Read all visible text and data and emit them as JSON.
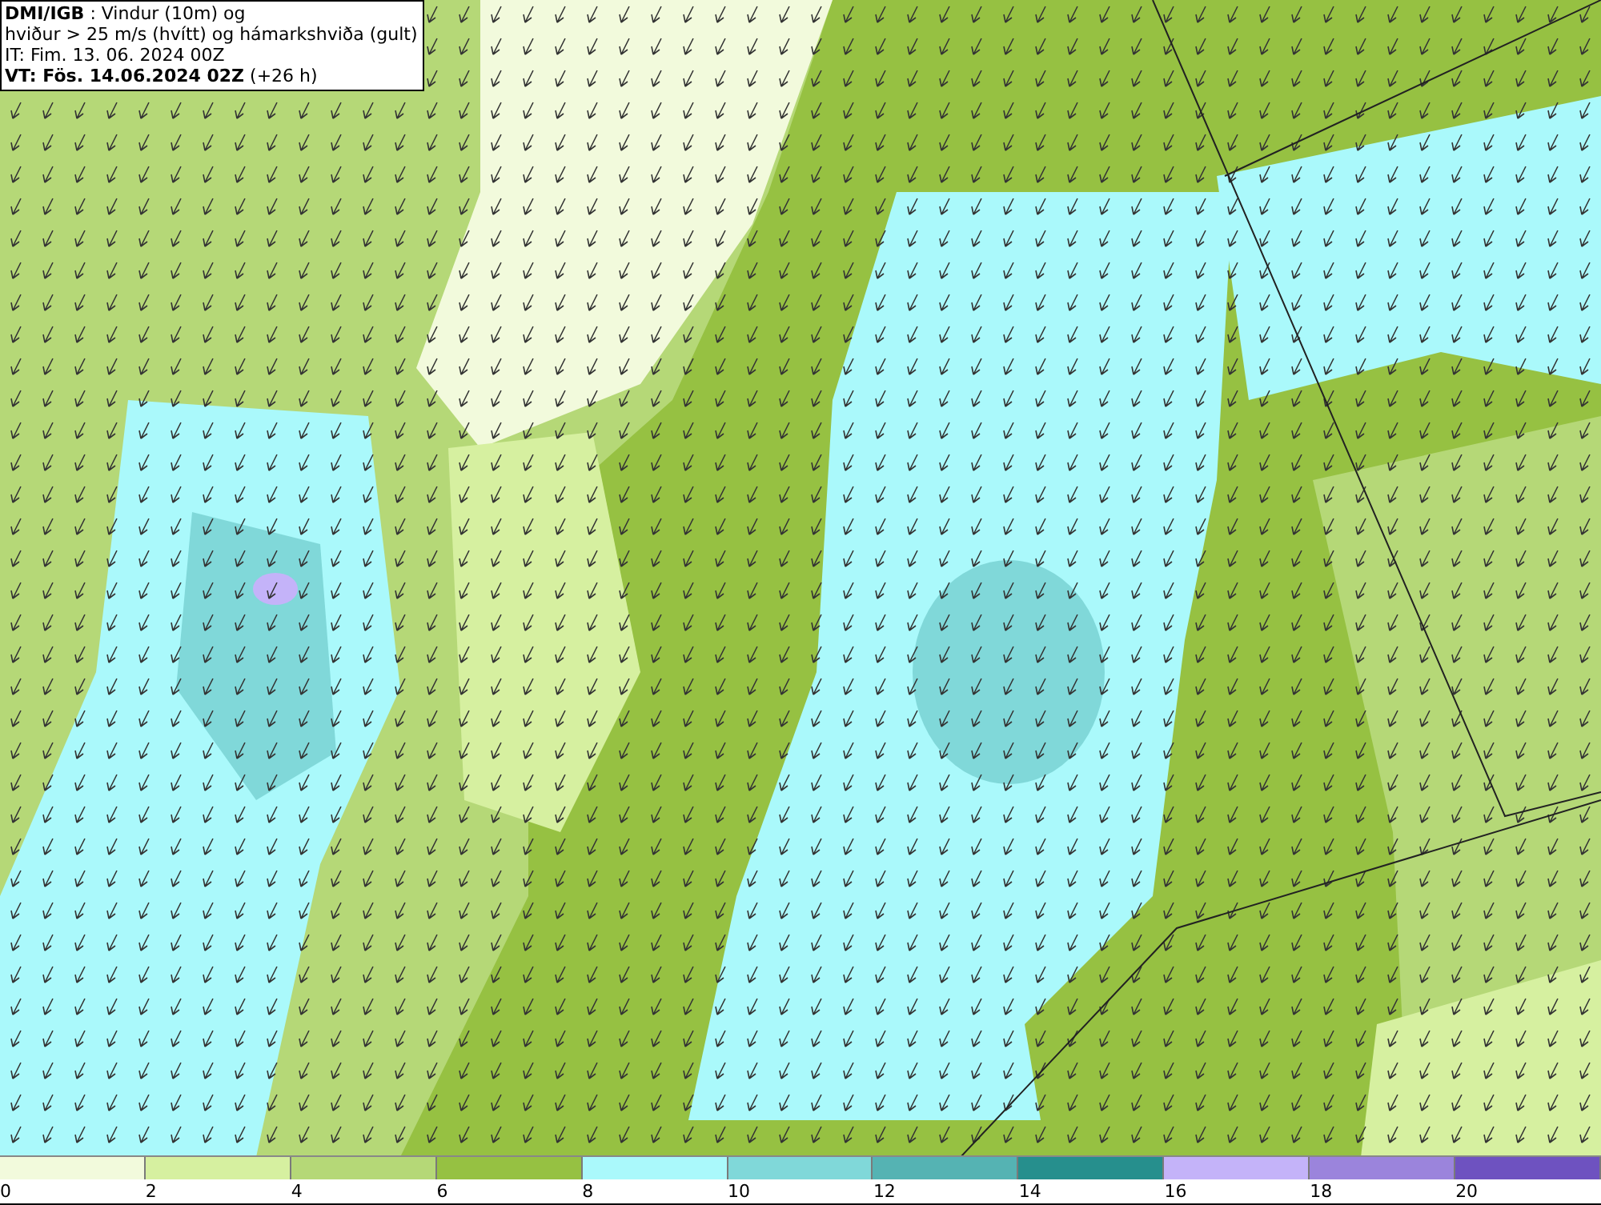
{
  "title_box": {
    "lines": [
      "**DMI/IGB** : Vindur (10m) og",
      "hviður > 25 m/s (hvítt) og hámarkshviða (gult)",
      "IT: Fim. 13. 06. 2024 00Z",
      "**VT: Fös. 14.06.2024 02Z** (+26 h)"
    ]
  },
  "legend": {
    "swatches": [
      {
        "color": "#f2fadc"
      },
      {
        "color": "#d6f0a0"
      },
      {
        "color": "#b5d877"
      },
      {
        "color": "#96c142"
      },
      {
        "color": "#aaf9fb"
      },
      {
        "color": "#80d8d9"
      },
      {
        "color": "#55b3b3"
      },
      {
        "color": "#268f8d"
      },
      {
        "color": "#c4b3f9"
      },
      {
        "color": "#9b84dc"
      },
      {
        "color": "#6e52c0"
      }
    ],
    "labels": [
      "0",
      "2",
      "4",
      "6",
      "8",
      "10",
      "12",
      "14",
      "16",
      "18",
      "20"
    ]
  }
}
